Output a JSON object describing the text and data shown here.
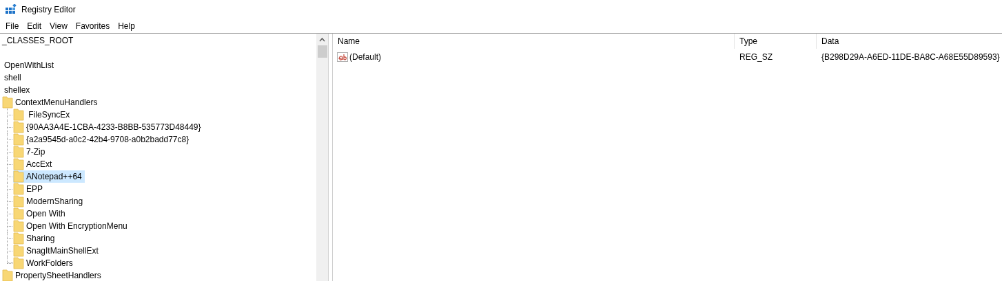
{
  "window": {
    "title": "Registry Editor"
  },
  "menu": [
    "File",
    "Edit",
    "View",
    "Favorites",
    "Help"
  ],
  "tree": [
    {
      "label": "_CLASSES_ROOT",
      "kind": "text",
      "selected": false
    },
    {
      "label": "OpenWithList",
      "kind": "text",
      "selected": false
    },
    {
      "label": "shell",
      "kind": "text",
      "selected": false
    },
    {
      "label": "shellex",
      "kind": "text",
      "selected": false
    },
    {
      "label": "ContextMenuHandlers",
      "kind": "folder",
      "selected": false,
      "children": [
        {
          "label": " FileSyncEx",
          "kind": "folder",
          "selected": false
        },
        {
          "label": "{90AA3A4E-1CBA-4233-B8BB-535773D48449}",
          "kind": "folder",
          "selected": false
        },
        {
          "label": "{a2a9545d-a0c2-42b4-9708-a0b2badd77c8}",
          "kind": "folder",
          "selected": false
        },
        {
          "label": "7-Zip",
          "kind": "folder",
          "selected": false
        },
        {
          "label": "AccExt",
          "kind": "folder",
          "selected": false
        },
        {
          "label": "ANotepad++64",
          "kind": "folder",
          "selected": true
        },
        {
          "label": "EPP",
          "kind": "folder",
          "selected": false
        },
        {
          "label": "ModernSharing",
          "kind": "folder",
          "selected": false
        },
        {
          "label": "Open With",
          "kind": "folder",
          "selected": false
        },
        {
          "label": "Open With EncryptionMenu",
          "kind": "folder",
          "selected": false
        },
        {
          "label": "Sharing",
          "kind": "folder",
          "selected": false
        },
        {
          "label": "SnagItMainShellExt",
          "kind": "folder",
          "selected": false
        },
        {
          "label": "WorkFolders",
          "kind": "folder",
          "selected": false
        }
      ]
    },
    {
      "label": "PropertySheetHandlers",
      "kind": "folder",
      "selected": false
    }
  ],
  "values": {
    "columns": [
      "Name",
      "Type",
      "Data"
    ],
    "rows": [
      {
        "name": "(Default)",
        "type": "REG_SZ",
        "data": "{B298D29A-A6ED-11DE-BA8C-A68E55D89593}"
      }
    ]
  }
}
